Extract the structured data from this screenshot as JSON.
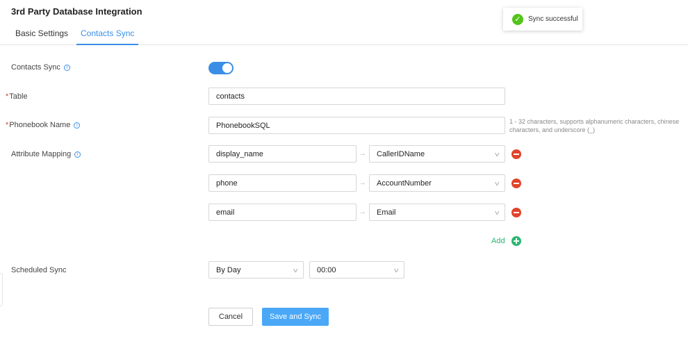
{
  "header": {
    "title": "3rd Party Database Integration",
    "tabs": [
      {
        "label": "Basic Settings"
      },
      {
        "label": "Contacts Sync",
        "active": true
      }
    ]
  },
  "toast": {
    "message": "Sync successful",
    "icon": "check-circle-icon",
    "color": "#52c41a"
  },
  "form": {
    "contacts_sync": {
      "label": "Contacts Sync",
      "enabled": true
    },
    "table": {
      "label": "Table",
      "required": true,
      "value": "contacts"
    },
    "phonebook_name": {
      "label": "Phonebook Name",
      "required": true,
      "value": "PhonebookSQL",
      "hint": "1 - 32 characters, supports alphanumeric characters, chinese characters, and underscore (_)"
    },
    "attribute_mapping": {
      "label": "Attribute Mapping",
      "arrow": "→",
      "rows": [
        {
          "source": "display_name",
          "target": "CallerIDName"
        },
        {
          "source": "phone",
          "target": "AccountNumber"
        },
        {
          "source": "email",
          "target": "Email"
        }
      ],
      "add_label": "Add"
    },
    "scheduled_sync": {
      "label": "Scheduled Sync",
      "frequency": "By Day",
      "time": "00:00"
    }
  },
  "actions": {
    "cancel_label": "Cancel",
    "save_label": "Save and Sync"
  },
  "colors": {
    "accent": "#3a8ee6",
    "danger": "#e0442b",
    "success": "#2bb673",
    "primary_button": "#4aa8f7"
  }
}
